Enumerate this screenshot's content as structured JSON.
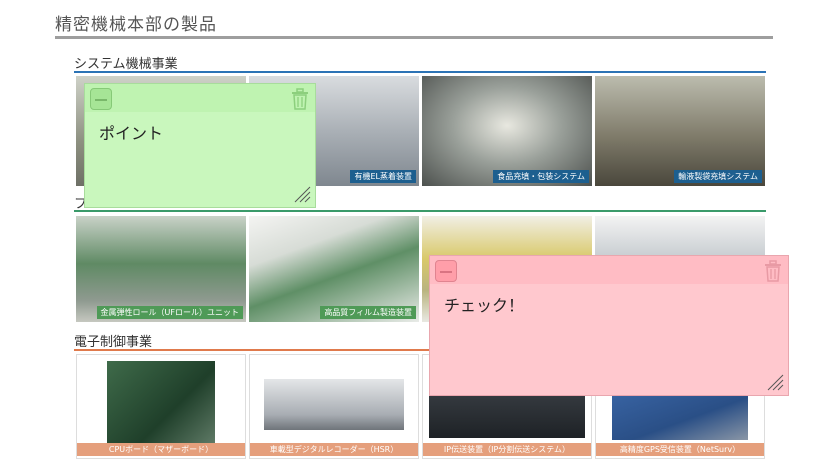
{
  "page": {
    "title": "精密機械本部の製品"
  },
  "sections": [
    {
      "title": "システム機械事業",
      "rule_color": "#2c73b5"
    },
    {
      "title": "フ",
      "rule_color": "#3a9a6a"
    },
    {
      "title": "電子制御事業",
      "rule_color": "#e07a4c"
    }
  ],
  "rows": [
    {
      "products": [
        {
          "caption": ""
        },
        {
          "caption": "有機EL蒸着装置"
        },
        {
          "caption": "食品充填・包装システム"
        },
        {
          "caption": "輸液製袋充填システム"
        }
      ]
    },
    {
      "products": [
        {
          "caption": "金属弾性ロール（UFロール）ユニット"
        },
        {
          "caption": "高品質フィルム製造装置"
        },
        {
          "caption": ""
        },
        {
          "caption": ""
        }
      ]
    },
    {
      "products": [
        {
          "caption": "CPUボード（マザーボード）"
        },
        {
          "caption": "車載型デジタルレコーダー（HSR）"
        },
        {
          "caption": "IP伝送装置（IP分割伝送システム）"
        },
        {
          "caption": "高精度GPS受信装置（NetSurv）"
        }
      ]
    }
  ],
  "notes": [
    {
      "text": "ポイント",
      "color": "#c9f7bd"
    },
    {
      "text": "チェック！",
      "color": "#ffc8ce"
    }
  ]
}
